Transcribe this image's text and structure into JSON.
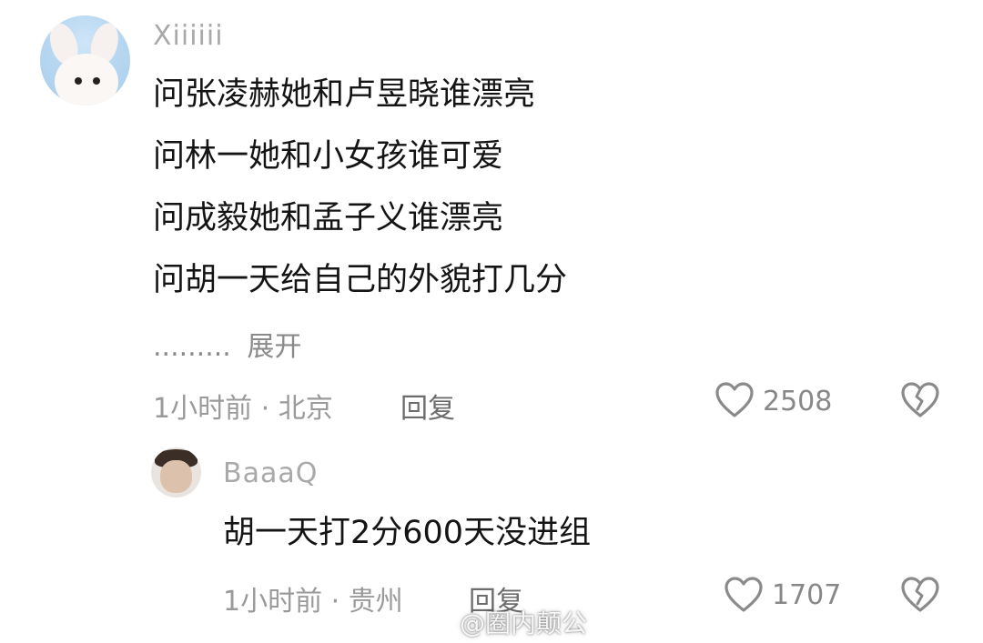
{
  "comment": {
    "username": "Xiiiiii",
    "lines": [
      "问张凌赫她和卢昱晓谁漂亮",
      "问林一她和小女孩谁可爱",
      "问成毅她和孟子义谁漂亮",
      "问胡一天给自己的外貌打几分"
    ],
    "ellipsis": ".........",
    "expand_label": "展开",
    "meta": "1小时前 · 北京",
    "reply_label": "回复",
    "likes": "2508"
  },
  "reply": {
    "username": "BaaaQ",
    "text": "胡一天打2分600天没进组",
    "meta": "1小时前 · 贵州",
    "reply_label": "回复",
    "likes": "1707"
  },
  "watermark": {
    "text": "@圈内颠公"
  },
  "icons": {
    "like": "heart-outline-icon",
    "dislike": "broken-heart-icon"
  }
}
